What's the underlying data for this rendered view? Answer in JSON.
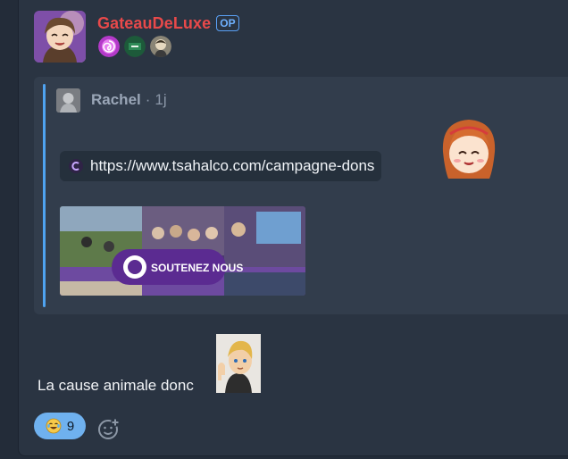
{
  "post": {
    "author": "GateauDeLuxe",
    "op_label": "OP",
    "avatar_icon": "anime-avatar-icon",
    "badges": [
      {
        "name": "spiral-badge-icon",
        "color": "#c447d6"
      },
      {
        "name": "flag-badge-icon",
        "color": "#2e7d4f"
      },
      {
        "name": "character-badge-icon",
        "color": "#c9c2b0"
      }
    ],
    "quote": {
      "author": "Rachel",
      "separator": "·",
      "time": "1j",
      "link_url": "https://www.tsahalco.com/campagne-dons",
      "preview_text": "SOUTENEZ NOUS"
    },
    "message": "La cause animale donc",
    "reaction": {
      "emoji": "laughing-crying-emoji-icon",
      "count": "9"
    }
  },
  "colors": {
    "author": "#e8494a",
    "op_badge": "#5aa0f5",
    "quote_bar": "#4fa3f0",
    "reaction_bg": "#6fb1ef"
  }
}
